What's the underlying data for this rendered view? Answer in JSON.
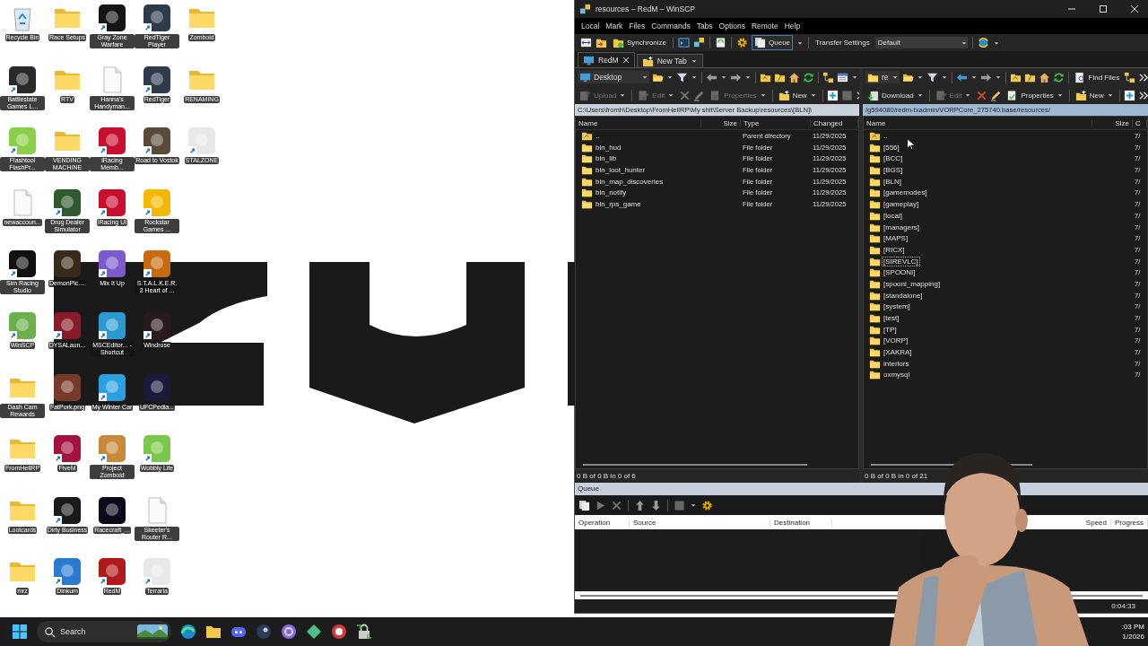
{
  "desktop": {
    "rows": [
      [
        {
          "label": "Recycle Bin",
          "kind": "bin",
          "shortcut": false
        },
        {
          "label": "Race Setups",
          "kind": "folder",
          "shortcut": false
        },
        {
          "label": "Gray Zone Warfare",
          "kind": "app",
          "shortcut": true,
          "color": "#151515"
        },
        {
          "label": "RedTiger Player",
          "kind": "app",
          "shortcut": true,
          "color": "#2f3a4a"
        },
        {
          "label": "Zomboid",
          "kind": "folder",
          "shortcut": false
        }
      ],
      [
        {
          "label": "Battlestate Games L...",
          "kind": "app",
          "shortcut": true,
          "color": "#2a2a2a"
        },
        {
          "label": "RTV",
          "kind": "folder",
          "shortcut": false
        },
        {
          "label": "Hanna's Handyman...",
          "kind": "file",
          "shortcut": false
        },
        {
          "label": "RedTiger",
          "kind": "app",
          "shortcut": true,
          "color": "#2f3a4a"
        },
        {
          "label": "RENAMING",
          "kind": "folder",
          "shortcut": false
        }
      ],
      [
        {
          "label": "Flashtool FlashPr...",
          "kind": "app",
          "shortcut": true,
          "color": "#8ad04a"
        },
        {
          "label": "VENDING MACHINE",
          "kind": "folder",
          "shortcut": false
        },
        {
          "label": "iRacing Memb...",
          "kind": "app",
          "shortcut": true,
          "color": "#c8102e"
        },
        {
          "label": "Road to Vostok",
          "kind": "app",
          "shortcut": true,
          "color": "#5a4a3a"
        },
        {
          "label": "STALZONE",
          "kind": "app",
          "shortcut": true,
          "color": "#e8e8e8"
        }
      ],
      [
        {
          "label": "newaccoun...",
          "kind": "file",
          "shortcut": false
        },
        {
          "label": "Drug Dealer Simulator",
          "kind": "app",
          "shortcut": true,
          "color": "#2e5a2e"
        },
        {
          "label": "iRacing UI",
          "kind": "app",
          "shortcut": true,
          "color": "#c8102e"
        },
        {
          "label": "Rockstar Games ...",
          "kind": "app",
          "shortcut": true,
          "color": "#f5b800"
        }
      ],
      [
        {
          "label": "Sim Racing Studio",
          "kind": "app",
          "shortcut": true,
          "color": "#111111"
        },
        {
          "label": "DemonPic....",
          "kind": "app",
          "shortcut": false,
          "color": "#3a2a1a"
        },
        {
          "label": "Mix It Up",
          "kind": "app",
          "shortcut": true,
          "color": "#7a5acc"
        },
        {
          "label": "S.T.A.L.K.E.R. 2 Heart of ...",
          "kind": "app",
          "shortcut": true,
          "color": "#c86a10"
        }
      ],
      [
        {
          "label": "WinSCP",
          "kind": "app",
          "shortcut": true,
          "color": "#6ab04c"
        },
        {
          "label": "DYSALaun...",
          "kind": "app",
          "shortcut": true,
          "color": "#8a1a2a"
        },
        {
          "label": "MSCEditor... - Shortcut",
          "kind": "app",
          "shortcut": true,
          "color": "#2a9ad0"
        },
        {
          "label": "Windrose",
          "kind": "app",
          "shortcut": true,
          "color": "#2a1a1e"
        }
      ],
      [
        {
          "label": "Dash Cam Rewards",
          "kind": "folder",
          "shortcut": false
        },
        {
          "label": "FatPork.png",
          "kind": "app",
          "shortcut": false,
          "color": "#7a3a2a"
        },
        {
          "label": "My Winter Car",
          "kind": "app",
          "shortcut": true,
          "color": "#2aa0e0"
        },
        {
          "label": "UFCPedia...",
          "kind": "app",
          "shortcut": false,
          "color": "#1a1a3a"
        }
      ],
      [
        {
          "label": "FromHellRP",
          "kind": "folder",
          "shortcut": false
        },
        {
          "label": "FiveM",
          "kind": "app",
          "shortcut": true,
          "color": "#a4123f"
        },
        {
          "label": "Project Zomboid",
          "kind": "app",
          "shortcut": true,
          "color": "#c88a3a"
        },
        {
          "label": "Wobbly Life",
          "kind": "app",
          "shortcut": true,
          "color": "#7ac84a"
        }
      ],
      [
        {
          "label": "Lootcards",
          "kind": "folder",
          "shortcut": false
        },
        {
          "label": "Dirty Business",
          "kind": "app",
          "shortcut": true,
          "color": "#1a1a1a"
        },
        {
          "label": "Racecraft_...",
          "kind": "app",
          "shortcut": false,
          "color": "#0a0a1a"
        },
        {
          "label": "Skeeter's Router R...",
          "kind": "file",
          "shortcut": false
        }
      ],
      [
        {
          "label": "mrz",
          "kind": "folder",
          "shortcut": false
        },
        {
          "label": "Dinkum",
          "kind": "app",
          "shortcut": true,
          "color": "#2a7ad0"
        },
        {
          "label": "RedM",
          "kind": "app",
          "shortcut": true,
          "color": "#b01a1a"
        },
        {
          "label": "Terraria",
          "kind": "app",
          "shortcut": true,
          "color": "#e8e8e8"
        }
      ]
    ]
  },
  "window": {
    "title": "resources – RedM – WinSCP"
  },
  "menu": [
    "Local",
    "Mark",
    "Files",
    "Commands",
    "Tabs",
    "Options",
    "Remote",
    "Help"
  ],
  "toolbar": {
    "synchronize": "Synchronize",
    "queue": "Queue",
    "transfer_settings_label": "Transfer Settings",
    "transfer_settings_value": "Default"
  },
  "tabs": [
    {
      "label": "RedM",
      "selected": true
    },
    {
      "label": "New Tab",
      "selected": false
    }
  ],
  "left_panel": {
    "location": "Desktop",
    "transfer": {
      "label": "Upload",
      "disabled": true
    },
    "edit": {
      "label": "Edit",
      "disabled": true
    },
    "delete": {
      "disabled": true
    },
    "properties": {
      "label": "Properties",
      "disabled": true
    },
    "new": {
      "label": "New",
      "disabled": false
    },
    "path": "C:\\Users\\fromh\\Desktop\\FromHellRP\\My shit\\Server Backup\\resources\\[BLN]\\",
    "active": false,
    "columns": [
      "Name",
      "Size",
      "Type",
      "Changed"
    ],
    "rows": [
      {
        "name": "..",
        "kind": "parent",
        "type": "Parent directory",
        "changed": "11/29/2025"
      },
      {
        "name": "bln_hud",
        "kind": "folder",
        "type": "File folder",
        "changed": "11/29/2025"
      },
      {
        "name": "bln_lib",
        "kind": "folder",
        "type": "File folder",
        "changed": "11/29/2025"
      },
      {
        "name": "bln_loot_hunter",
        "kind": "folder",
        "type": "File folder",
        "changed": "11/29/2025"
      },
      {
        "name": "bln_map_discoveries",
        "kind": "folder",
        "type": "File folder",
        "changed": "11/29/2025"
      },
      {
        "name": "bln_notify",
        "kind": "folder",
        "type": "File folder",
        "changed": "11/29/2025"
      },
      {
        "name": "bln_rps_game",
        "kind": "folder",
        "type": "File folder",
        "changed": "11/29/2025"
      }
    ],
    "status": "0 B of 0 B in 0 of 6"
  },
  "right_panel": {
    "location": "re",
    "find_files": "Find Files",
    "transfer": {
      "label": "Download",
      "disabled": false
    },
    "edit": {
      "label": "Edit",
      "disabled": true
    },
    "delete": {
      "disabled": false
    },
    "properties": {
      "label": "Properties",
      "disabled": false
    },
    "new": {
      "label": "New",
      "disabled": false
    },
    "path": "/g594080/redm-txadmin/VORPCore_275740.base/resources/",
    "active": true,
    "columns": [
      "Name",
      "Size",
      "C"
    ],
    "rows": [
      {
        "name": "..",
        "kind": "parent",
        "changed": "7/",
        "focused": false
      },
      {
        "name": "[556]",
        "kind": "folder",
        "changed": "7/",
        "focused": false
      },
      {
        "name": "[BCC]",
        "kind": "folder",
        "changed": "7/",
        "focused": false
      },
      {
        "name": "[BGS]",
        "kind": "folder",
        "changed": "7/",
        "focused": false
      },
      {
        "name": "[BLN]",
        "kind": "folder",
        "changed": "7/",
        "focused": false
      },
      {
        "name": "[gamemodes]",
        "kind": "folder",
        "changed": "7/",
        "focused": false
      },
      {
        "name": "[gameplay]",
        "kind": "folder",
        "changed": "7/",
        "focused": false
      },
      {
        "name": "[local]",
        "kind": "folder",
        "changed": "7/",
        "focused": false
      },
      {
        "name": "[managers]",
        "kind": "folder",
        "changed": "7/",
        "focused": false
      },
      {
        "name": "[MAPS]",
        "kind": "folder",
        "changed": "7/",
        "focused": false
      },
      {
        "name": "[RICX]",
        "kind": "folder",
        "changed": "7/",
        "focused": false
      },
      {
        "name": "[SIREVLC]",
        "kind": "folder",
        "changed": "7/",
        "focused": true
      },
      {
        "name": "[SPOONI]",
        "kind": "folder",
        "changed": "7/",
        "focused": false
      },
      {
        "name": "[spooni_mapping]",
        "kind": "folder",
        "changed": "7/",
        "focused": false
      },
      {
        "name": "[standalone]",
        "kind": "folder",
        "changed": "7/",
        "focused": false
      },
      {
        "name": "[system]",
        "kind": "folder",
        "changed": "7/",
        "focused": false
      },
      {
        "name": "[test]",
        "kind": "folder",
        "changed": "7/",
        "focused": false
      },
      {
        "name": "[TP]",
        "kind": "folder",
        "changed": "7/",
        "focused": false
      },
      {
        "name": "[VORP]",
        "kind": "folder",
        "changed": "7/",
        "focused": false
      },
      {
        "name": "[XAKRA]",
        "kind": "folder",
        "changed": "7/",
        "focused": false
      },
      {
        "name": "interiors",
        "kind": "folder",
        "changed": "7/",
        "focused": false
      },
      {
        "name": "oxmysql",
        "kind": "folder",
        "changed": "7/",
        "focused": false
      }
    ],
    "status": "0 B of 0 B in 0 of 21"
  },
  "queue": {
    "title": "Queue",
    "columns": [
      "Operation",
      "Source",
      "Destination"
    ],
    "columns_right": [
      "Speed",
      "Progress"
    ],
    "status": "0:04:33"
  },
  "taskbar": {
    "search_placeholder": "Search",
    "clock_time": ":03 PM",
    "clock_date": "1/2026"
  }
}
